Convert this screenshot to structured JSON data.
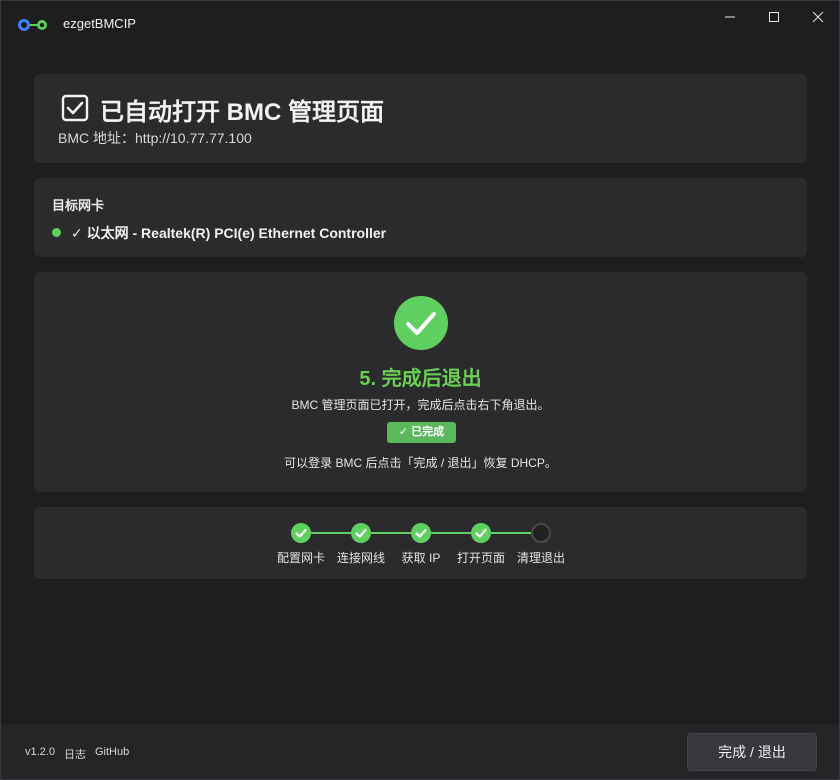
{
  "app": {
    "title": "ezgetBMCIP",
    "version": "v1.2.0"
  },
  "header": {
    "title": "已自动打开 BMC 管理页面",
    "subtitle": "BMC 地址：http://10.77.77.100"
  },
  "nic": {
    "label": "目标网卡",
    "name": "✓ 以太网 - Realtek(R) PCI(e) Ethernet Controller",
    "status_color": "#5fcf5f"
  },
  "step": {
    "title": "5. 完成后退出",
    "description": "BMC 管理页面已打开，完成后点击右下角退出。",
    "badge": "✓ 已完成",
    "hint": "可以登录 BMC 后点击「完成 / 退出」恢复 DHCP。"
  },
  "stepper": [
    {
      "label": "配置网卡",
      "status": "done"
    },
    {
      "label": "连接网线",
      "status": "done"
    },
    {
      "label": "获取 IP",
      "status": "done"
    },
    {
      "label": "打开页面",
      "status": "done"
    },
    {
      "label": "清理退出",
      "status": "pending"
    }
  ],
  "footer": {
    "log": "日志",
    "github": "GitHub",
    "finish_button": "完成 / 退出"
  },
  "colors": {
    "accent_green": "#5fcf5f",
    "title_green": "#6bcf55",
    "background": "#1e1e21",
    "card": "#2b2b2e"
  },
  "icons": [
    "app-logo-icon",
    "minimize-icon",
    "maximize-icon",
    "close-icon",
    "checkbox-icon",
    "success-check-icon",
    "step-check-icon"
  ]
}
